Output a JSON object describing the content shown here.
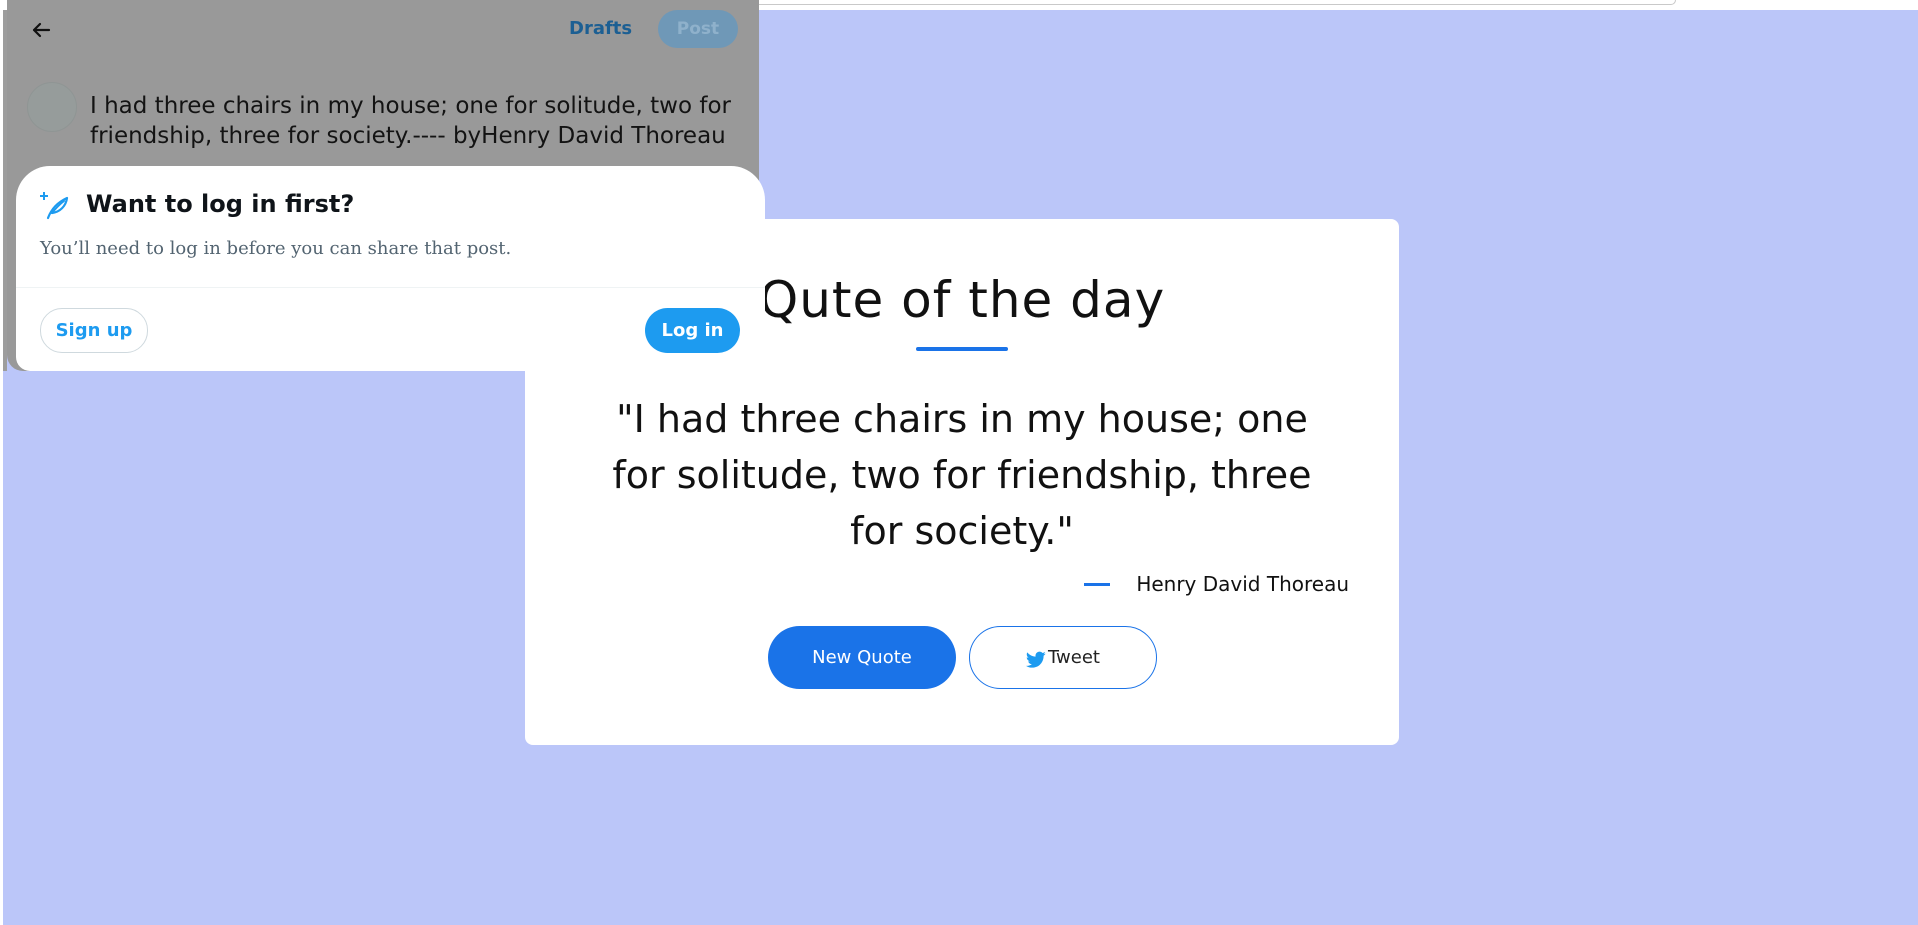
{
  "quote_page": {
    "title": "Qute of the day",
    "quote_text": "\"I had three chairs in my house; one for solitude, two for friendship, three for society.\"",
    "author": "Henry David Thoreau",
    "new_quote_label": "New Quote",
    "tweet_label": "Tweet",
    "background_color": "#bbc6f9",
    "accent_color": "#1a73e8"
  },
  "composer": {
    "drafts_label": "Drafts",
    "post_label": "Post",
    "text": "I had three chairs in my house; one for solitude, two for friendship, three for society.---- byHenry David Thoreau",
    "back_icon": "arrow-left-icon"
  },
  "login_dialog": {
    "title": "Want to log in first?",
    "subtitle": "You’ll need to log in before you can share that post.",
    "signup_label": "Sign up",
    "login_label": "Log in",
    "icon": "feather-sparkle-icon",
    "accent_color": "#1d9bf0"
  }
}
